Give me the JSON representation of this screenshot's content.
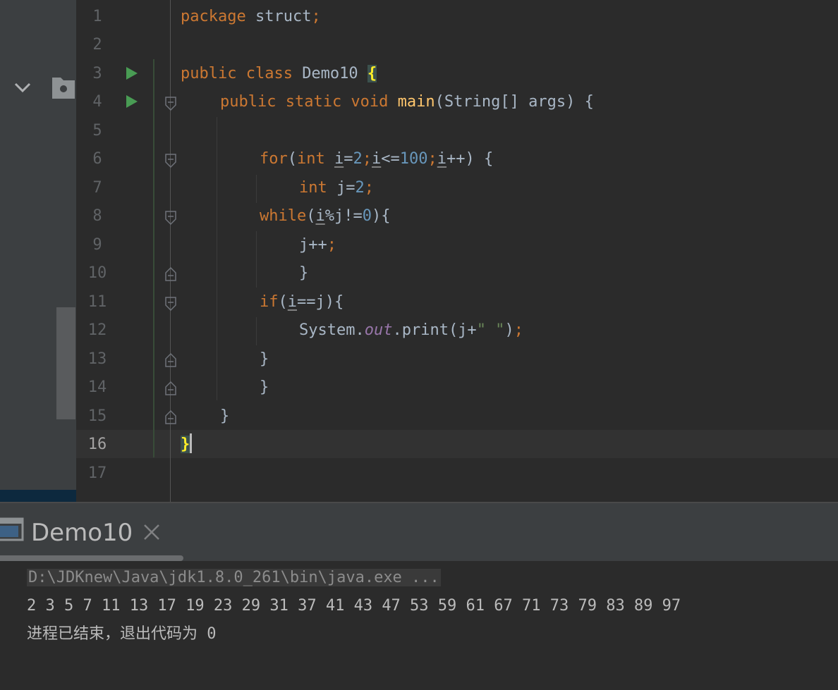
{
  "editor": {
    "line_numbers": [
      "1",
      "2",
      "3",
      "4",
      "5",
      "6",
      "7",
      "8",
      "9",
      "10",
      "11",
      "12",
      "13",
      "14",
      "15",
      "16",
      "17"
    ],
    "code": {
      "l1": {
        "kw": "package ",
        "name": "struct",
        "semi": ";"
      },
      "l3": {
        "kw": "public class ",
        "name": "Demo10 ",
        "brace": "{"
      },
      "l4": {
        "kw": "public static void ",
        "fn": "main",
        "rest": "(String[] args) {"
      },
      "l6": {
        "kw_for": "for",
        "p1": "(",
        "kw_int": "int ",
        "i1": "i",
        "eq": "=",
        "n2": "2",
        "sc1": ";",
        "i2": "i",
        "le": "<=",
        "n100": "100",
        "sc2": ";",
        "i3": "i",
        "rest": "++) {"
      },
      "l7": {
        "kw": "int ",
        "j": "j=",
        "n": "2",
        "semi": ";"
      },
      "l8": {
        "kw": "while",
        "p1": "(",
        "i": "i",
        "mid": "%j!=",
        "n": "0",
        "rest": "){"
      },
      "l9": {
        "text": "j++",
        "semi": ";"
      },
      "l10": {
        "text": "}"
      },
      "l11": {
        "kw": "if",
        "p1": "(",
        "i": "i",
        "rest": "==j){"
      },
      "l12": {
        "obj": "System.",
        "field": "out",
        "call": ".print(j+",
        "str": "\" \"",
        "close": ")",
        "semi": ";"
      },
      "l13": {
        "text": "}"
      },
      "l14": {
        "text": "}"
      },
      "l15": {
        "text": "}"
      },
      "l16": {
        "text": "}"
      }
    }
  },
  "run_panel": {
    "tab_label": "Demo10",
    "command": "D:\\JDKnew\\Java\\jdk1.8.0_261\\bin\\java.exe ...",
    "output": "2 3 5 7 11 13 17 19 23 29 31 37 41 43 47 53 59 61 67 71 73 79 83 89 97",
    "exit_message": "进程已结束，退出代码为 0"
  },
  "colors": {
    "keyword": "#cc7832",
    "number": "#6897bb",
    "string": "#6a8759",
    "method": "#ffc66d",
    "field": "#9876aa",
    "text": "#a9b7c6",
    "background": "#2b2b2b",
    "panel": "#3c3f41"
  },
  "icons": {
    "run_gutter": "run-triangle-icon",
    "fold": "fold-marker-icon",
    "tab": "console-tab-icon",
    "close": "close-icon"
  }
}
